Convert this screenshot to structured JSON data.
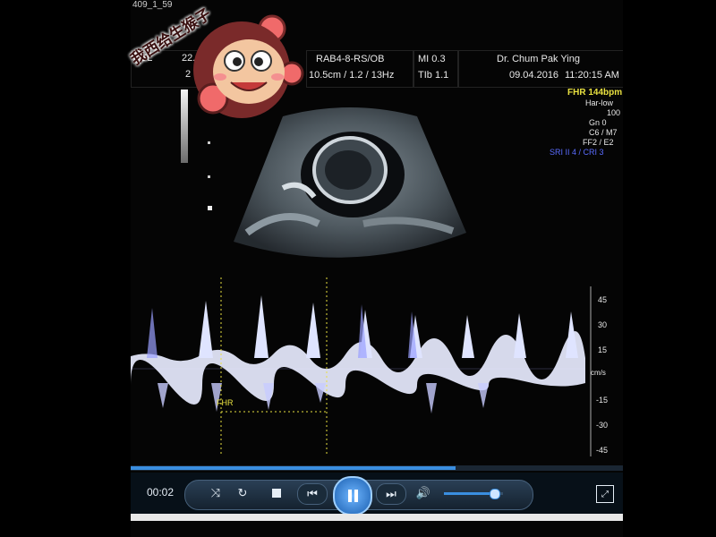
{
  "overlay": {
    "file_label": "409_1_59",
    "sticker_text": "我西给生猴子",
    "sticker_colors": {
      "primary": "#f06a6a",
      "fur": "#7a2a2a",
      "face": "#f3c6a0"
    }
  },
  "header": {
    "patient_left_1": "PUL",
    "patient_left_2": "22.0",
    "patient_left_3": "2",
    "patient_left_4": "0d",
    "probe": "RAB4-8-RS/OB",
    "params": "10.5cm / 1.2 / 13Hz",
    "mi": "MI  0.3",
    "tib": "TIb  1.1",
    "doctor": "Dr. Chum Pak Ying",
    "date": "09.04.2016",
    "time": "11:20:15 AM"
  },
  "right_panel": {
    "fhr": "FHR 144bpm",
    "line1": "Har-low",
    "line2": "100",
    "line3": "Gn   0",
    "line4": "C6 / M7",
    "line5": "FF2 / E2",
    "line6": "SRI II 4 / CRI 3"
  },
  "doppler": {
    "scale_labels": [
      "45",
      "30",
      "15",
      "cm/s",
      "-15",
      "-30",
      "-45"
    ],
    "fhr_marker": "FHR",
    "colors": {
      "waveform": "#e8ecff",
      "spike": "#9aa0ff",
      "marker": "#e8e040"
    }
  },
  "player": {
    "time": "00:02",
    "progress": 0.66,
    "volume": 0.85,
    "colors": {
      "accent": "#3a8ee0",
      "bar": "#071018"
    },
    "icons": [
      "shuffle-icon",
      "repeat-icon",
      "stop-icon",
      "previous-icon",
      "play-pause-icon",
      "next-icon",
      "volume-icon",
      "fullscreen-icon"
    ]
  }
}
